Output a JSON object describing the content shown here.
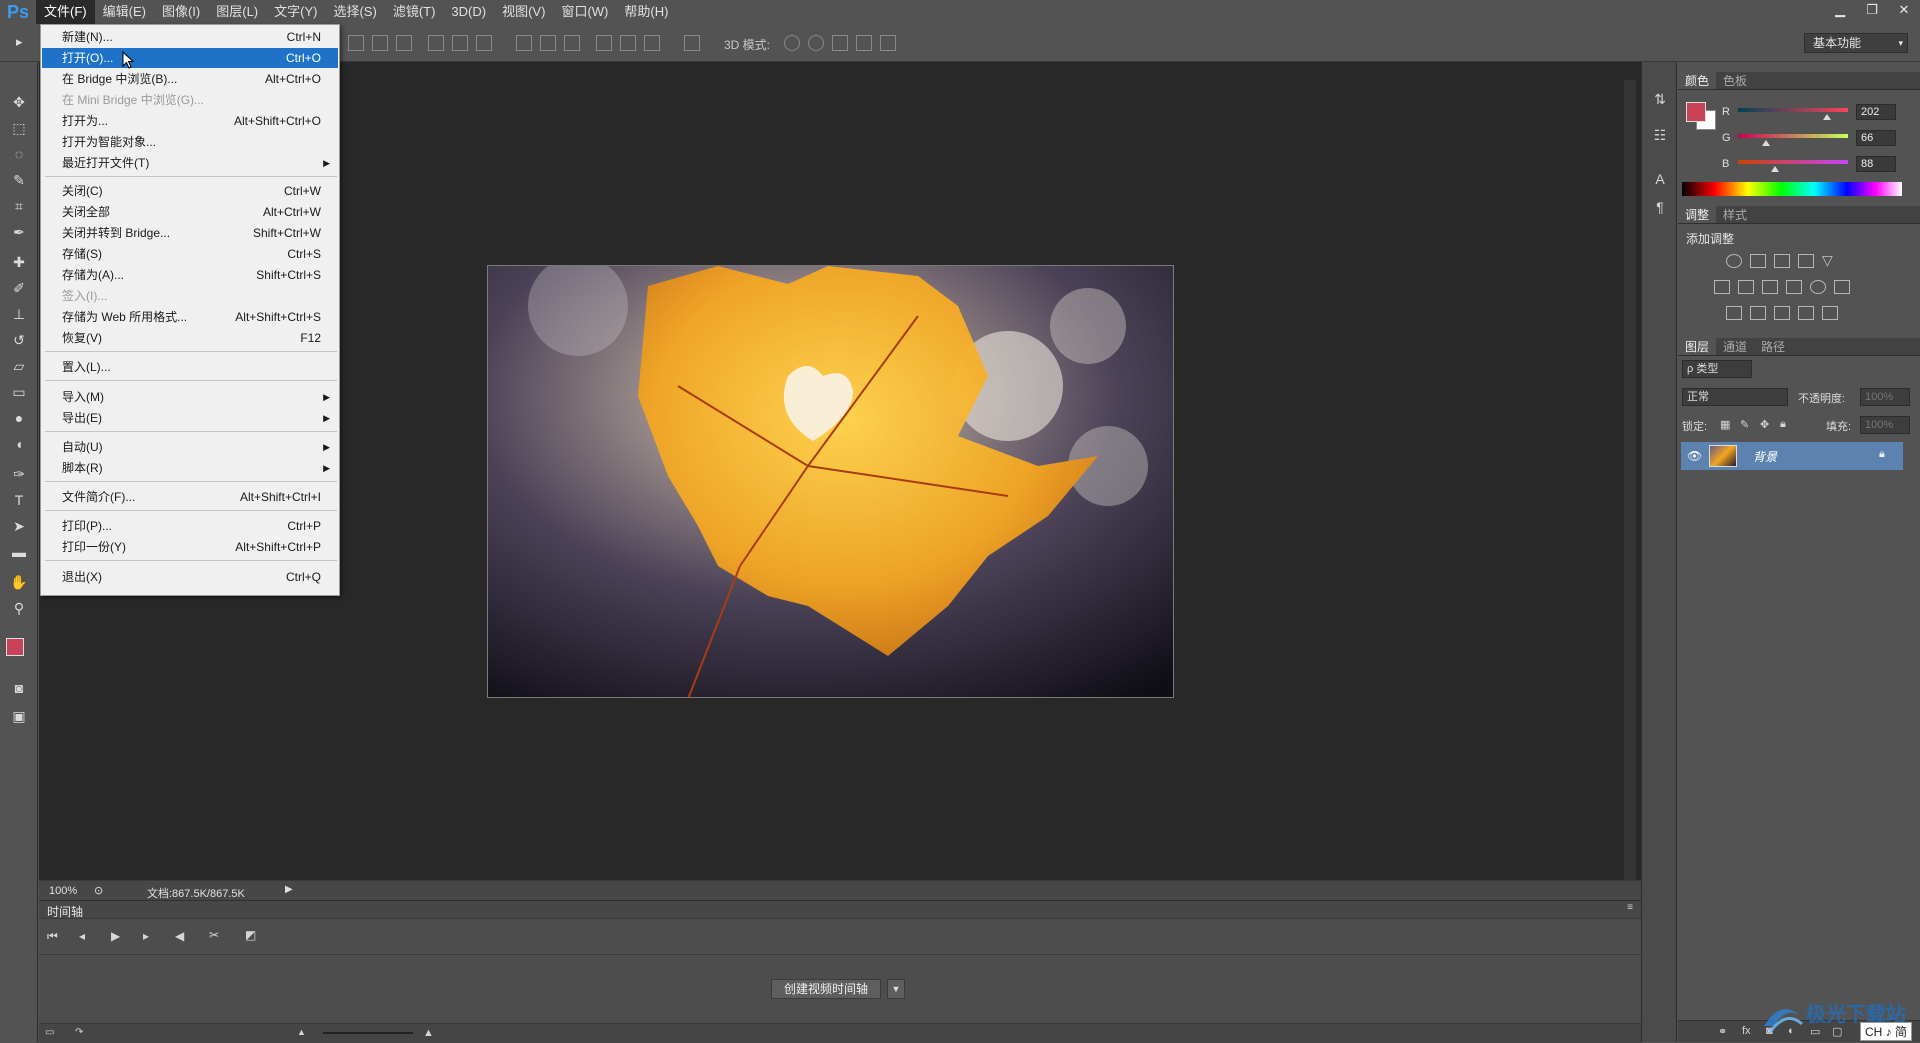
{
  "app": {
    "logo": "Ps"
  },
  "menubar": {
    "items": [
      "文件(F)",
      "编辑(E)",
      "图像(I)",
      "图层(L)",
      "文字(Y)",
      "选择(S)",
      "滤镜(T)",
      "3D(D)",
      "视图(V)",
      "窗口(W)",
      "帮助(H)"
    ],
    "active_index": 0
  },
  "window_controls": {
    "minimize": "▁",
    "restore": "❐",
    "close": "✕"
  },
  "options_bar": {
    "mode_3d": "3D 模式:",
    "workspace": "基本功能"
  },
  "file_menu": {
    "items": [
      {
        "label": "新建(N)...",
        "shortcut": "Ctrl+N"
      },
      {
        "label": "打开(O)...",
        "shortcut": "Ctrl+O"
      },
      {
        "label": "在 Bridge 中浏览(B)...",
        "shortcut": "Alt+Ctrl+O"
      },
      {
        "label": "在 Mini Bridge 中浏览(G)...",
        "shortcut": ""
      },
      {
        "label": "打开为...",
        "shortcut": "Alt+Shift+Ctrl+O"
      },
      {
        "label": "打开为智能对象...",
        "shortcut": ""
      },
      {
        "label": "最近打开文件(T)",
        "shortcut": ""
      },
      {
        "label": "关闭(C)",
        "shortcut": "Ctrl+W"
      },
      {
        "label": "关闭全部",
        "shortcut": "Alt+Ctrl+W"
      },
      {
        "label": "关闭并转到 Bridge...",
        "shortcut": "Shift+Ctrl+W"
      },
      {
        "label": "存储(S)",
        "shortcut": "Ctrl+S"
      },
      {
        "label": "存储为(A)...",
        "shortcut": "Shift+Ctrl+S"
      },
      {
        "label": "签入(I)...",
        "shortcut": ""
      },
      {
        "label": "存储为 Web 所用格式...",
        "shortcut": "Alt+Shift+Ctrl+S"
      },
      {
        "label": "恢复(V)",
        "shortcut": "F12"
      },
      {
        "label": "置入(L)...",
        "shortcut": ""
      },
      {
        "label": "导入(M)",
        "shortcut": ""
      },
      {
        "label": "导出(E)",
        "shortcut": ""
      },
      {
        "label": "自动(U)",
        "shortcut": ""
      },
      {
        "label": "脚本(R)",
        "shortcut": ""
      },
      {
        "label": "文件简介(F)...",
        "shortcut": "Alt+Shift+Ctrl+I"
      },
      {
        "label": "打印(P)...",
        "shortcut": "Ctrl+P"
      },
      {
        "label": "打印一份(Y)",
        "shortcut": "Alt+Shift+Ctrl+P"
      },
      {
        "label": "退出(X)",
        "shortcut": "Ctrl+Q"
      }
    ],
    "highlighted": "打开(O)...",
    "submenu_arrow": "▶"
  },
  "document": {
    "zoom": "100%",
    "info": "文档:867.5K/867.5K"
  },
  "timeline": {
    "title": "时间轴",
    "create_button": "创建视频时间轴",
    "arrow": "▼"
  },
  "color_panel": {
    "tabs": [
      "颜色",
      "色板"
    ],
    "channels": [
      {
        "name": "R",
        "value": "202"
      },
      {
        "name": "G",
        "value": "66"
      },
      {
        "name": "B",
        "value": "88"
      }
    ],
    "foreground": "#ca4258"
  },
  "adjust_panel": {
    "tabs": [
      "调整",
      "样式"
    ],
    "title": "添加调整"
  },
  "layers_panel": {
    "tabs": [
      "图层",
      "通道",
      "路径"
    ],
    "filter": "ρ 类型",
    "blend": "正常",
    "opacity_label": "不透明度:",
    "opacity": "100%",
    "lock_label": "锁定:",
    "fill_label": "填充:",
    "fill": "100%",
    "layer_name": "背景"
  },
  "watermark": {
    "text": "极光下载站",
    "sub": "CH ♪ 简"
  }
}
